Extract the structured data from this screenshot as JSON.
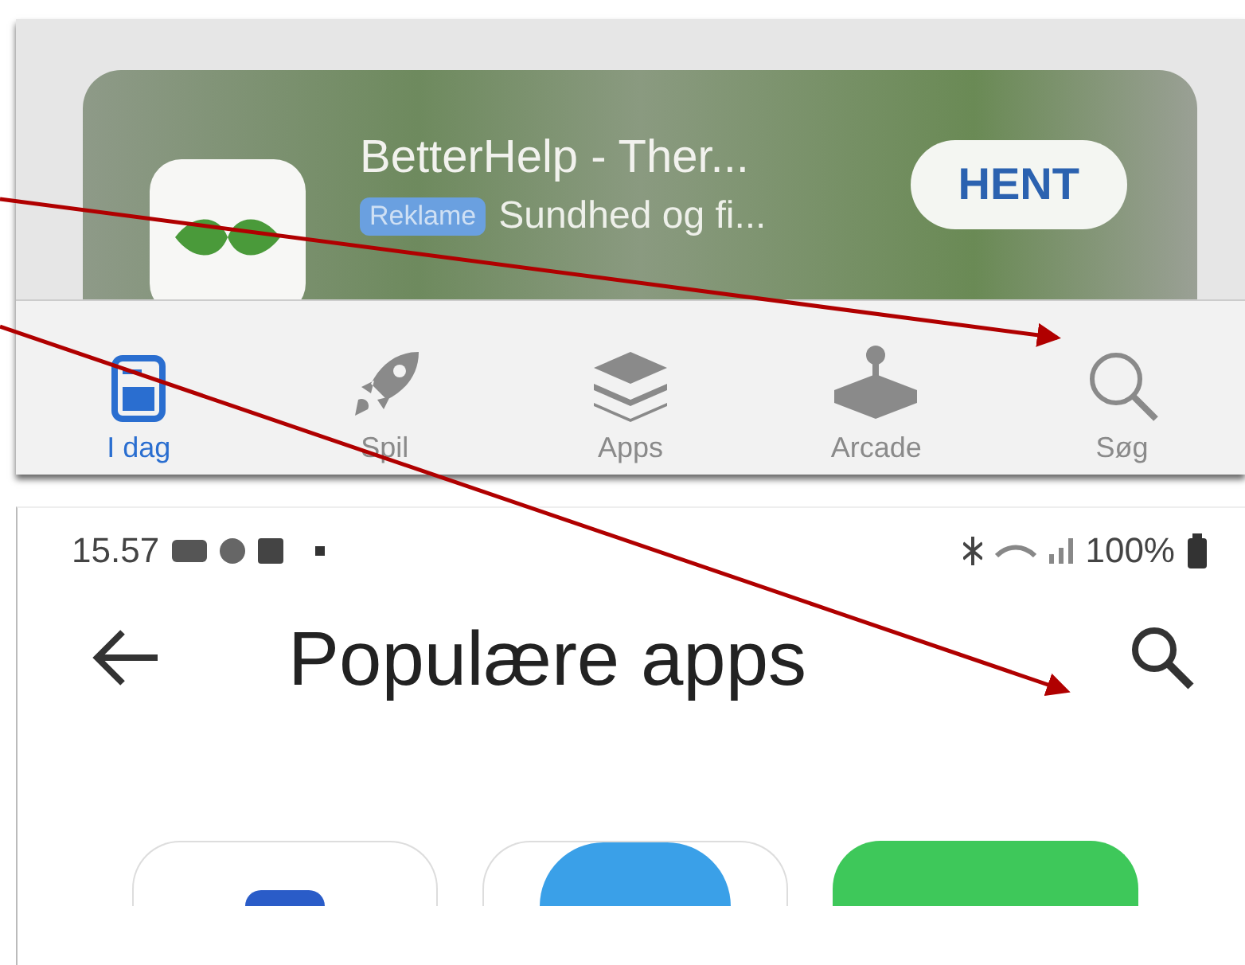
{
  "app_store": {
    "ad": {
      "title": "BetterHelp - Ther...",
      "badge": "Reklame",
      "subtitle": "Sundhed og fi...",
      "button": "HENT"
    },
    "tabs": [
      {
        "label": "I dag",
        "selected": true
      },
      {
        "label": "Spil",
        "selected": false
      },
      {
        "label": "Apps",
        "selected": false
      },
      {
        "label": "Arcade",
        "selected": false
      },
      {
        "label": "Søg",
        "selected": false
      }
    ]
  },
  "play_store": {
    "status_bar": {
      "time": "15.57",
      "battery": "100%"
    },
    "title": "Populære apps"
  }
}
